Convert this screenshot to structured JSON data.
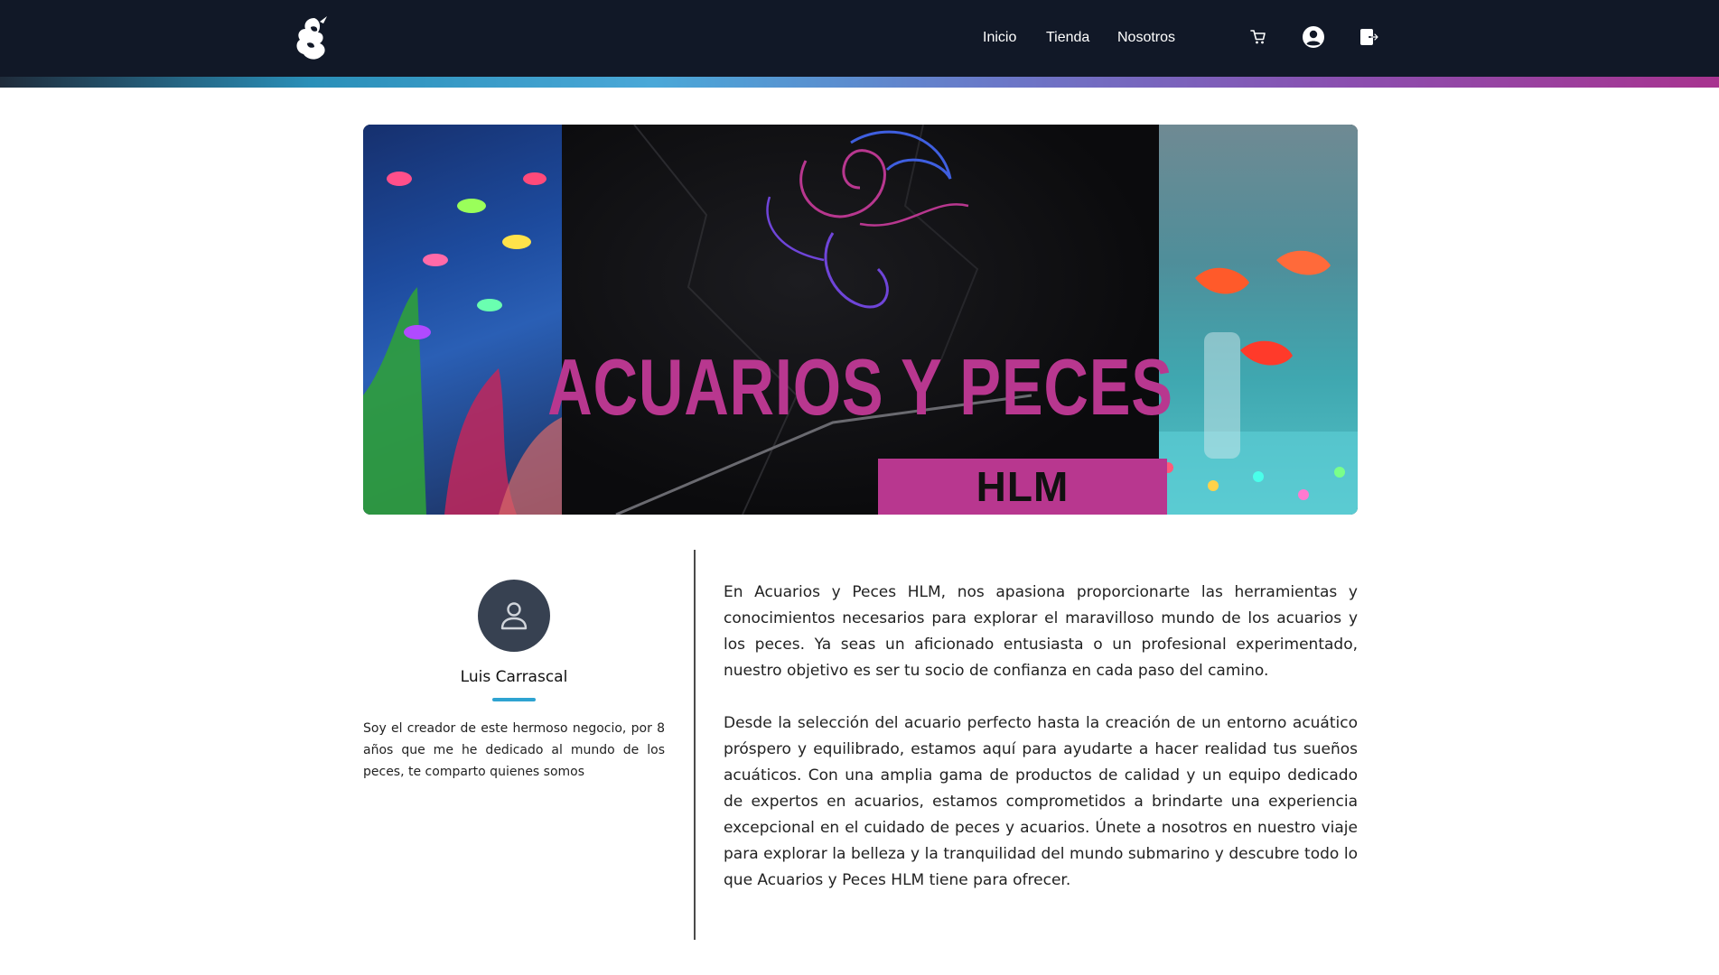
{
  "header": {
    "brand_icon": "seahorse-logo-icon",
    "nav": [
      {
        "label": "Inicio"
      },
      {
        "label": "Tienda"
      },
      {
        "label": "Nosotros"
      }
    ],
    "icons": [
      "cart-icon",
      "user-circle-icon",
      "logout-icon"
    ]
  },
  "banner": {
    "title": "ACUARIOS Y PECES",
    "badge": "HLM"
  },
  "author": {
    "avatar_icon": "user-icon",
    "name": "Luis Carrascal",
    "bio": "Soy el creador de este hermoso negocio, por 8 años que me he dedicado al mundo de los peces, te comparto quienes somos"
  },
  "about": {
    "paragraphs": [
      "En Acuarios y Peces HLM, nos apasiona proporcionarte las herramientas y conocimientos necesarios para explorar el maravilloso mundo de los acuarios y los peces. Ya seas un aficionado entusiasta o un profesional experimentado, nuestro objetivo es ser tu socio de confianza en cada paso del camino.",
      "Desde la selección del acuario perfecto hasta la creación de un entorno acuático próspero y equilibrado, estamos aquí para ayudarte a hacer realidad tus sueños acuáticos. Con una amplia gama de productos de calidad y un equipo dedicado de expertos en acuarios, estamos comprometidos a brindarte una experiencia excepcional en el cuidado de peces y acuarios. Únete a nosotros en nuestro viaje para explorar la belleza y la tranquilidad del mundo submarino y descubre todo lo que Acuarios y Peces HLM tiene para ofrecer."
    ]
  },
  "colors": {
    "header_bg": "#111827",
    "accent_pink": "#b8378f",
    "accent_blue": "#2ea3d1",
    "avatar_bg": "#374151"
  }
}
